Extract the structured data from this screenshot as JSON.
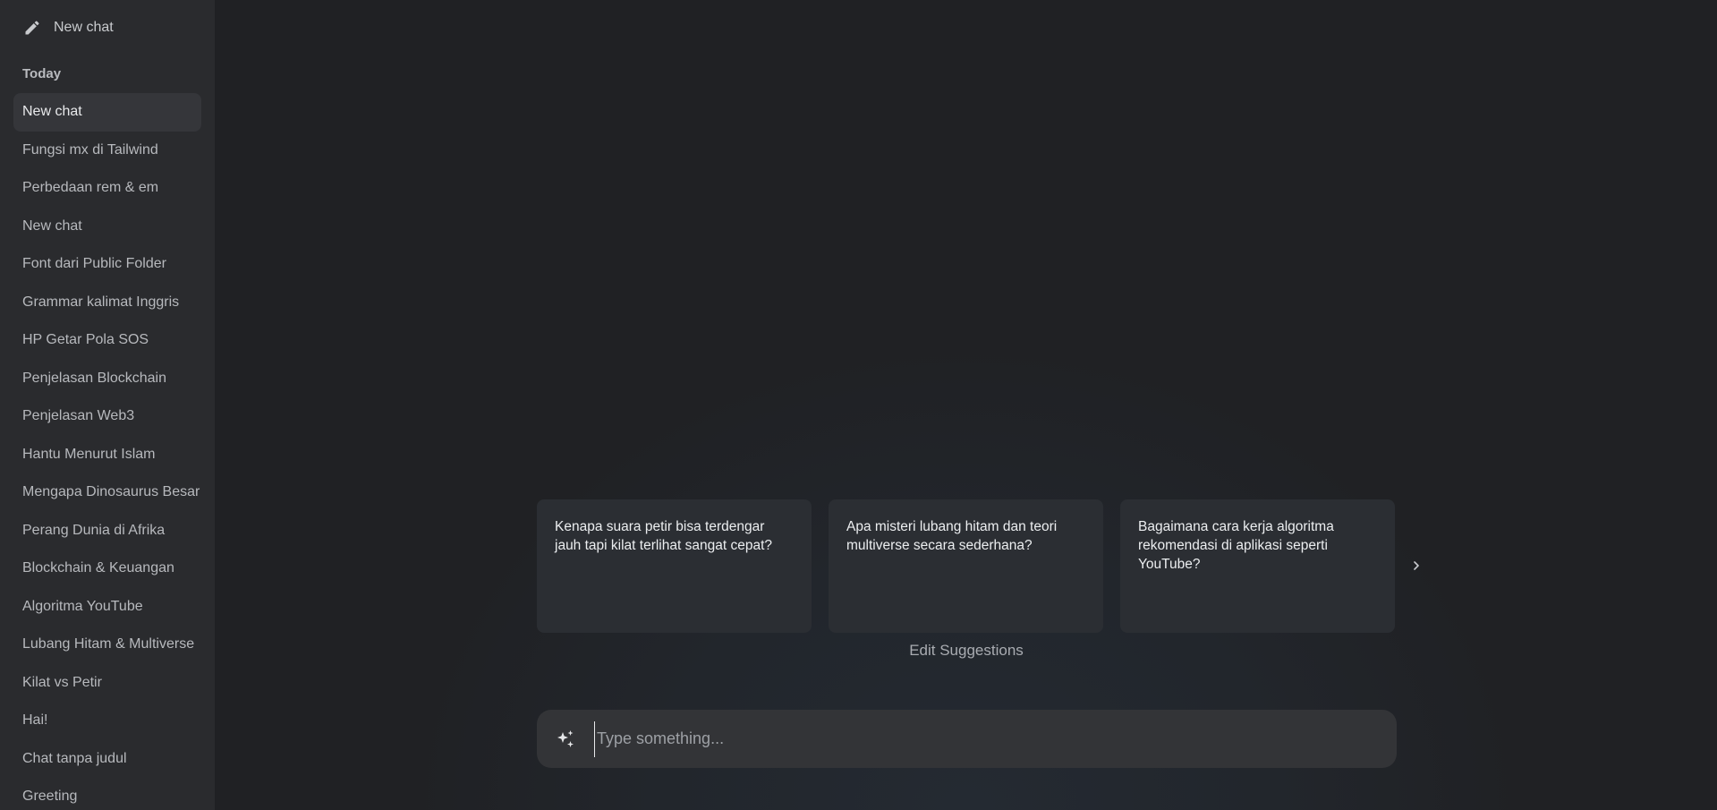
{
  "sidebar": {
    "new_chat_label": "New chat",
    "section_label": "Today",
    "items": [
      {
        "label": "New chat",
        "active": true
      },
      {
        "label": "Fungsi mx di Tailwind"
      },
      {
        "label": "Perbedaan rem & em"
      },
      {
        "label": "New chat"
      },
      {
        "label": "Font dari Public Folder"
      },
      {
        "label": "Grammar kalimat Inggris"
      },
      {
        "label": "HP Getar Pola SOS"
      },
      {
        "label": "Penjelasan Blockchain"
      },
      {
        "label": "Penjelasan Web3"
      },
      {
        "label": "Hantu Menurut Islam"
      },
      {
        "label": "Mengapa Dinosaurus Besar"
      },
      {
        "label": "Perang Dunia di Afrika"
      },
      {
        "label": "Blockchain & Keuangan"
      },
      {
        "label": "Algoritma YouTube"
      },
      {
        "label": "Lubang Hitam & Multiverse"
      },
      {
        "label": "Kilat vs Petir"
      },
      {
        "label": "Hai!"
      },
      {
        "label": "Chat tanpa judul"
      },
      {
        "label": "Greeting"
      }
    ]
  },
  "suggestions": {
    "cards": [
      "Kenapa suara petir bisa terdengar jauh tapi kilat terlihat sangat cepat?",
      "Apa misteri lubang hitam dan teori multiverse secara sederhana?",
      "Bagaimana cara kerja algoritma rekomendasi di aplikasi seperti YouTube?"
    ],
    "edit_label": "Edit Suggestions"
  },
  "composer": {
    "placeholder": "Type something...",
    "value": ""
  },
  "icons": {
    "new_chat": "pencil-icon",
    "composer": "sparkles-icon",
    "next": "chevron-right-icon"
  }
}
